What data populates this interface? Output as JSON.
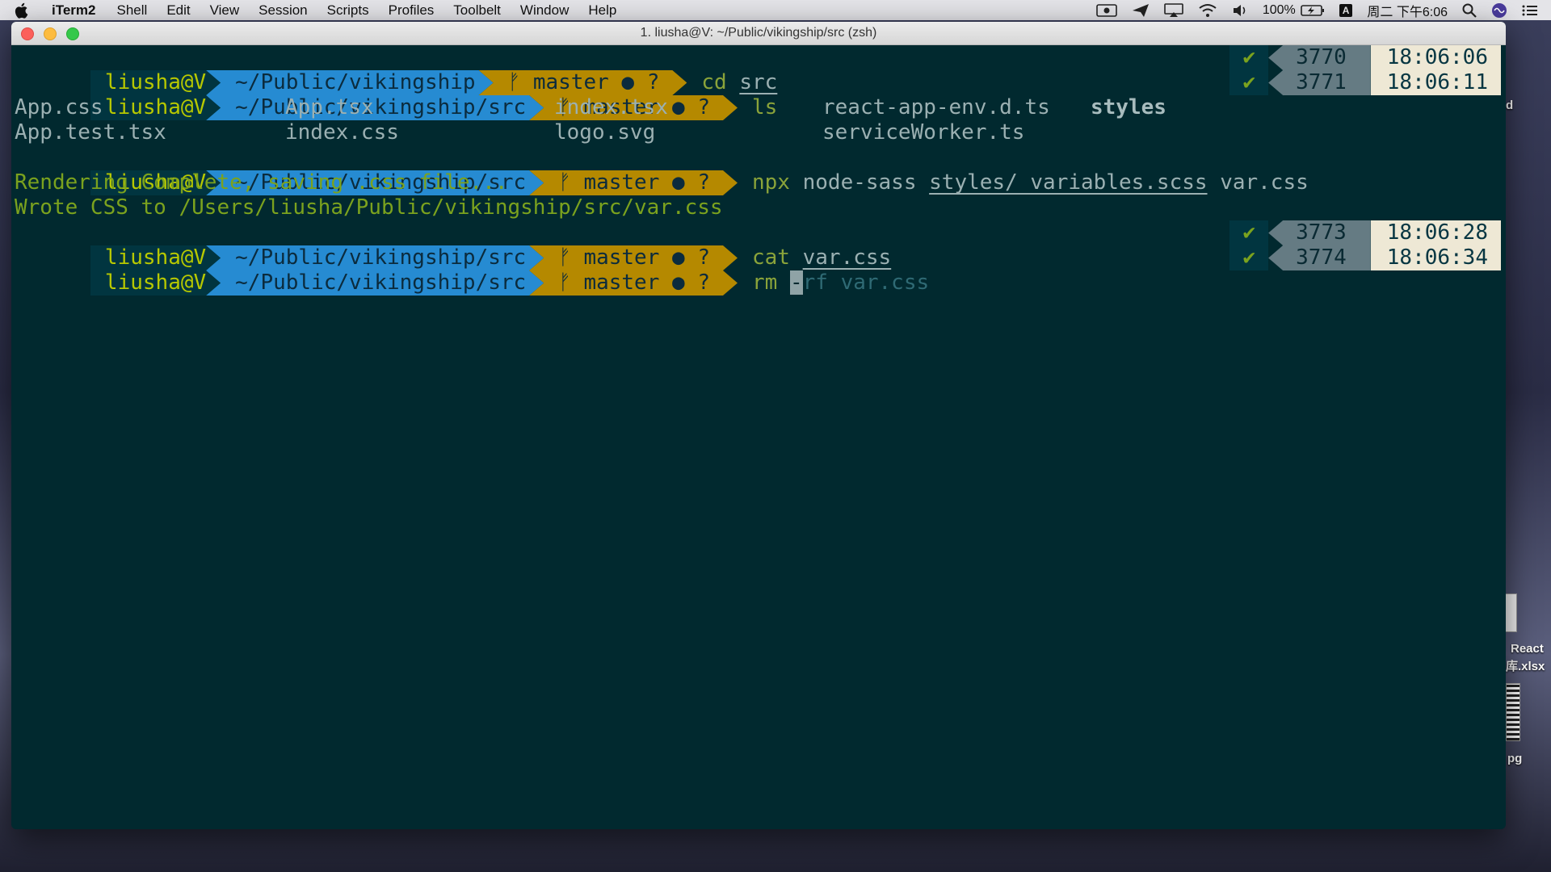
{
  "menubar": {
    "app": "iTerm2",
    "items": [
      "Shell",
      "Edit",
      "View",
      "Session",
      "Scripts",
      "Profiles",
      "Toolbelt",
      "Window",
      "Help"
    ],
    "battery": "100%",
    "ime": "A",
    "clock": "周二 下午6:06"
  },
  "window": {
    "title": "1. liusha@V: ~/Public/vikingship/src (zsh)"
  },
  "prompts": [
    {
      "user": "liusha@V",
      "path": "~/Public/vikingship",
      "git": "ᚠ master ● ?",
      "cmd": "cd",
      "arg": "src",
      "status": "✔",
      "num": "3770",
      "time": "18:06:06"
    },
    {
      "user": "liusha@V",
      "path": "~/Public/vikingship/src",
      "git": "ᚠ master ● ?",
      "cmd": "ls",
      "arg": "",
      "status": "✔",
      "num": "3771",
      "time": "18:06:11"
    },
    {
      "user": "liusha@V",
      "path": "~/Public/vikingship/src",
      "git": "ᚠ master ● ?",
      "cmd": "npx",
      "arg1": "node-sass",
      "arg2": "styles/_variables.scss",
      "arg3": "var.css"
    },
    {
      "user": "liusha@V",
      "path": "~/Public/vikingship/src",
      "git": "ᚠ master ● ?",
      "cmd": "cat",
      "arg": "var.css",
      "status": "✔",
      "num": "3773",
      "time": "18:06:28"
    },
    {
      "user": "liusha@V",
      "path": "~/Public/vikingship/src",
      "git": "ᚠ master ● ?",
      "cmd": "rm",
      "cursor": "-",
      "rest": "rf var.css",
      "status": "✔",
      "num": "3774",
      "time": "18:06:34"
    }
  ],
  "ls_output": {
    "row1": [
      "App.css",
      "App.tsx",
      "index.tsx",
      "react-app-env.d.ts",
      "styles"
    ],
    "row2": [
      "App.test.tsx",
      "index.css",
      "logo.svg",
      "serviceWorker.ts"
    ]
  },
  "output_lines": [
    "Rendering Complete, saving .css file...",
    "Wrote CSS to /Users/liusha/Public/vikingship/src/var.css"
  ],
  "desktop": {
    "label1": "React",
    "label2": "库.xlsx",
    "label3": "pg",
    "label4": "d"
  },
  "colors": {
    "terminal_bg": "#01292f",
    "path_segment": "#268bd2",
    "git_segment": "#b58900",
    "user_text": "#b7c800",
    "success_check": "#7ba21e"
  }
}
